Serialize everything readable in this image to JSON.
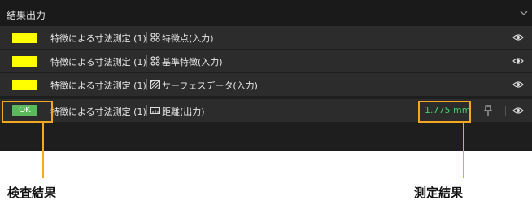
{
  "panel": {
    "title": "結果出力"
  },
  "rows": [
    {
      "step": "特徴による寸法測定 (1)",
      "item": "特徴点(入力)"
    },
    {
      "step": "特徴による寸法測定 (1)",
      "item": "基準特徴(入力)"
    },
    {
      "step": "特徴による寸法測定 (1)",
      "item": "サーフェスデータ(入力)"
    },
    {
      "status": "OK",
      "step": "特徴による寸法測定 (1)",
      "item": "距離(出力)",
      "value": "1.775 mm"
    }
  ],
  "annotations": {
    "left": "検査結果",
    "right": "測定結果"
  },
  "colors": {
    "swatch": "#ffff00",
    "ok": "#5cb85c",
    "value": "#3fd06a",
    "highlight": "#f5a623"
  },
  "icons": [
    "chevron-down-icon",
    "point-icon",
    "reference-feature-icon",
    "surface-data-icon",
    "distance-icon",
    "pin-icon",
    "eye-icon"
  ]
}
